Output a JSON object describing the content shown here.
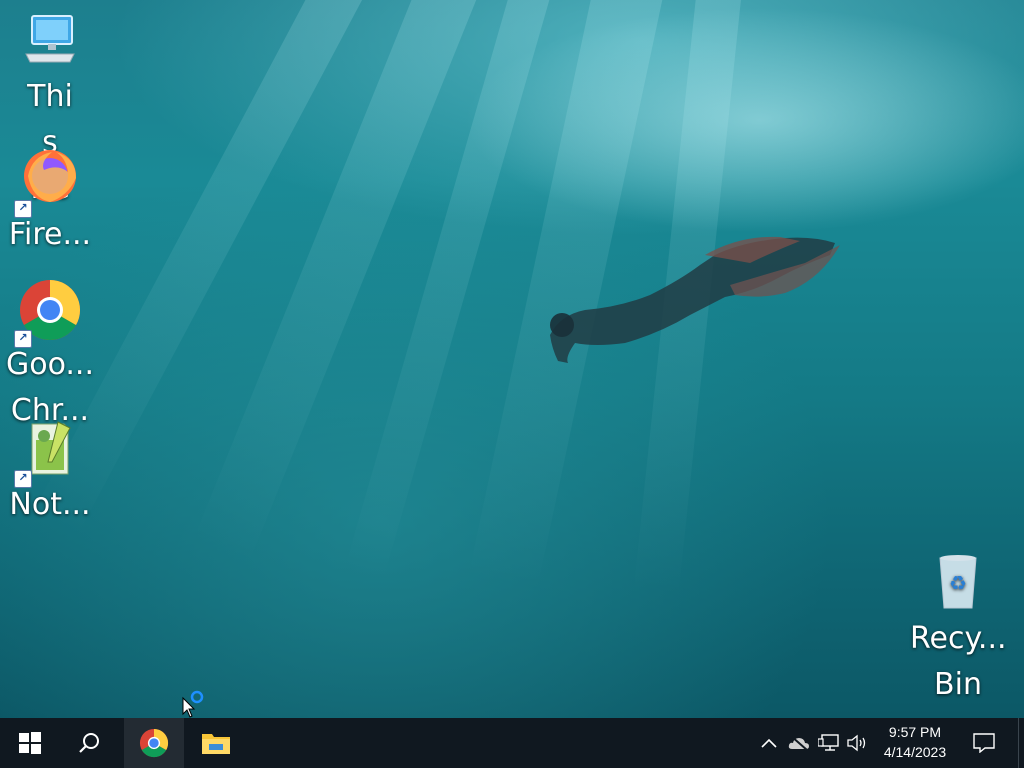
{
  "desktop": {
    "icons": [
      {
        "label": "This PC",
        "icon": "computer-icon"
      },
      {
        "label": "Fire...",
        "icon": "firefox-icon"
      },
      {
        "label": "Goo... Chr...",
        "icon": "chrome-icon"
      },
      {
        "label": "Not...",
        "icon": "notepadpp-icon"
      },
      {
        "label": "Recy... Bin",
        "icon": "recycle-bin-icon"
      }
    ]
  },
  "taskbar": {
    "start": {
      "icon": "windows-start-icon"
    },
    "search": {
      "icon": "search-icon"
    },
    "pinned": [
      {
        "name": "Google Chrome",
        "icon": "chrome-icon",
        "active": true
      },
      {
        "name": "File Explorer",
        "icon": "folder-icon",
        "active": false
      }
    ],
    "tray": {
      "icons": [
        "chevron-up-icon",
        "onedrive-offline-icon",
        "network-icon",
        "volume-icon"
      ]
    },
    "clock": {
      "time": "9:57 PM",
      "date": "4/14/2023"
    },
    "notifications": {
      "icon": "action-center-icon"
    }
  },
  "colors": {
    "taskbar_bg": "#101820",
    "water_dark": "#0c5866",
    "water_light": "#8fe3ea"
  }
}
